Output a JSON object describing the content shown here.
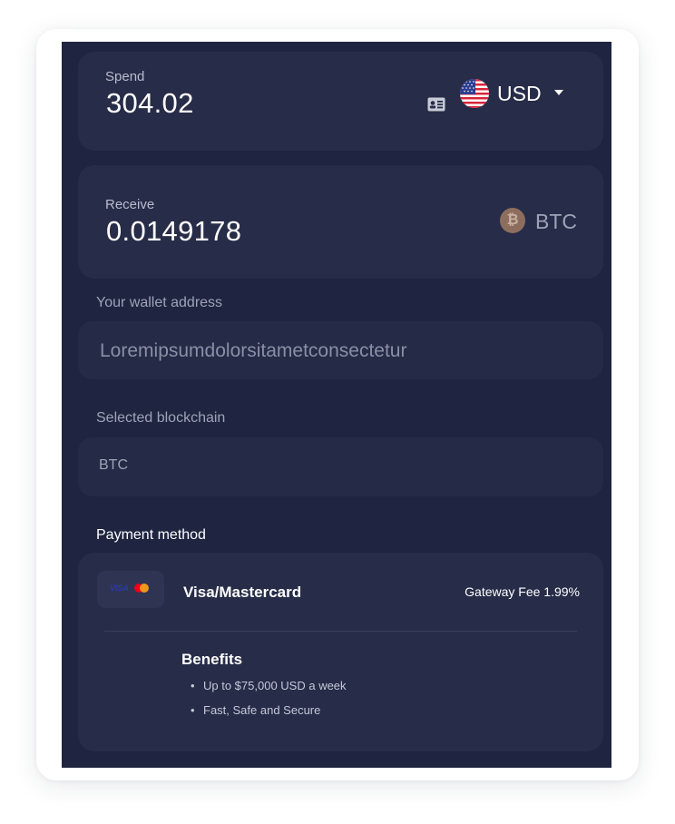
{
  "spend": {
    "label": "Spend",
    "amount": "304.02",
    "currency": "USD",
    "icons": [
      "id-card-icon",
      "us-flag-icon",
      "caret-down-icon"
    ]
  },
  "receive": {
    "label": "Receive",
    "amount": "0.0149178",
    "currency": "BTC",
    "coin_symbol": "₿",
    "icons": [
      "bitcoin-icon"
    ]
  },
  "wallet": {
    "label": "Your wallet address",
    "placeholder": "Loremipsumdolorsitametconsectetur"
  },
  "blockchain": {
    "label": "Selected blockchain",
    "value": "BTC"
  },
  "payment": {
    "label": "Payment method",
    "logo_text": "VISA",
    "method_name": "Visa/Mastercard",
    "gateway_fee": "Gateway Fee 1.99%",
    "benefits_title": "Benefits",
    "benefits": [
      "Up to $75,000 USD a week",
      "Fast, Safe and Secure"
    ]
  },
  "colors": {
    "panel_bg": "#1f2440",
    "box_bg": "#272c48",
    "text_primary": "#ffffff",
    "text_muted": "#9ea3b8",
    "btc_coin": "#8d6e5e"
  }
}
